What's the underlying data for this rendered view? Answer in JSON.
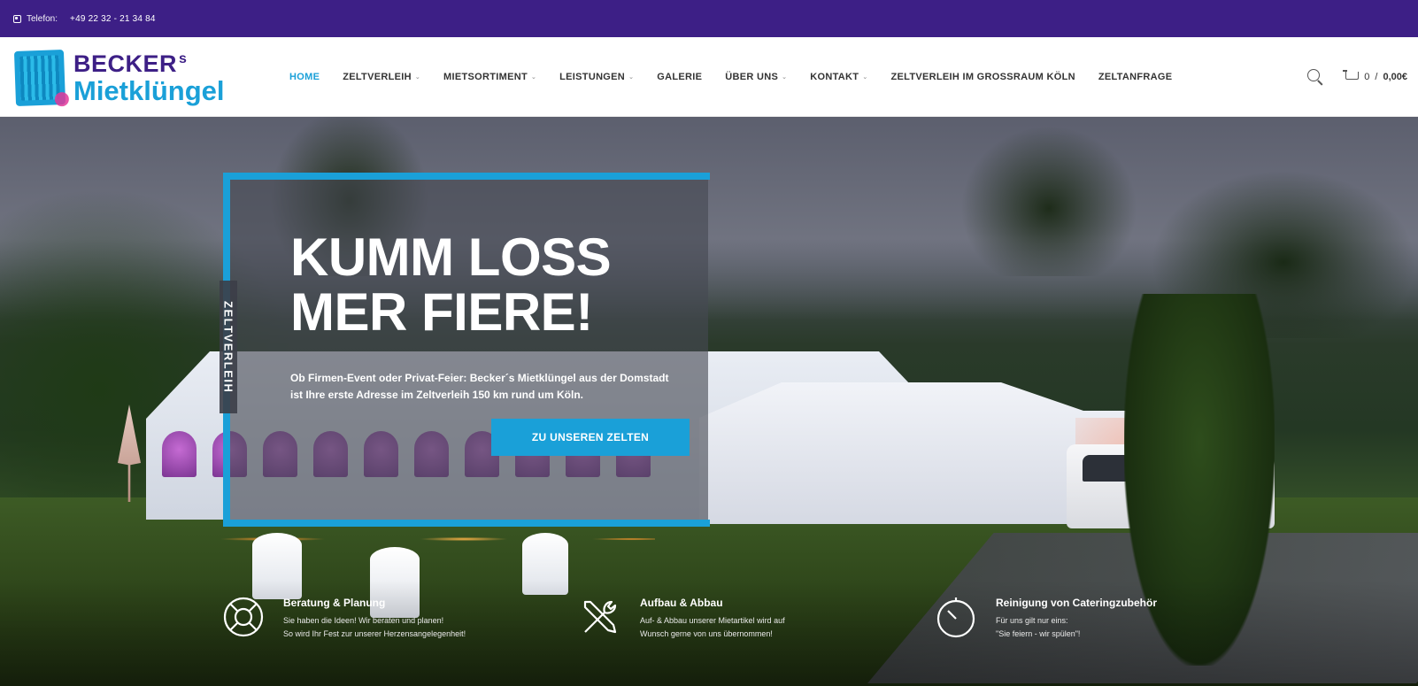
{
  "topbar": {
    "phone_label": "Telefon:",
    "phone_number": "+49 22 32 - 21 34 84"
  },
  "logo": {
    "line1": "BECKER",
    "line1_sup": "s",
    "line2": "Mietklüngel"
  },
  "nav": {
    "items": [
      {
        "label": "HOME",
        "active": true,
        "dropdown": false
      },
      {
        "label": "ZELTVERLEIH",
        "active": false,
        "dropdown": true
      },
      {
        "label": "MIETSORTIMENT",
        "active": false,
        "dropdown": true
      },
      {
        "label": "LEISTUNGEN",
        "active": false,
        "dropdown": true
      },
      {
        "label": "GALERIE",
        "active": false,
        "dropdown": false
      },
      {
        "label": "ÜBER UNS",
        "active": false,
        "dropdown": true
      },
      {
        "label": "KONTAKT",
        "active": false,
        "dropdown": true
      },
      {
        "label": "ZELTVERLEIH IM GROSSRAUM KÖLN",
        "active": false,
        "dropdown": false
      },
      {
        "label": "ZELTANFRAGE",
        "active": false,
        "dropdown": false
      }
    ],
    "cart_count": "0",
    "cart_total": "0,00€"
  },
  "hero": {
    "vertical_label": "ZELTVERLEIH",
    "headline_line1": "KUMM LOSS",
    "headline_line2": "MER FIERE!",
    "subtitle": "Ob Firmen-Event oder Privat-Feier: Becker´s Mietklüngel aus der Domstadt ist Ihre erste Adresse im Zeltverleih 150 km rund um Köln.",
    "cta_label": "ZU UNSEREN ZELTEN"
  },
  "features": [
    {
      "title": "Beratung & Planung",
      "line1": "Sie haben die Ideen! Wir beraten und planen!",
      "line2": "So wird Ihr Fest zur unserer Herzensangelegenheit!",
      "icon": "lifebuoy-icon"
    },
    {
      "title": "Aufbau & Abbau",
      "line1": "Auf- & Abbau unserer Mietartikel wird auf",
      "line2": "Wunsch gerne von uns übernommen!",
      "icon": "tools-icon"
    },
    {
      "title": "Reinigung von Cateringzubehör",
      "line1": "Für uns gilt nur eins:",
      "line2": "\"Sie feiern - wir spülen\"!",
      "icon": "timer-icon"
    }
  ],
  "colors": {
    "topbar": "#3d1f86",
    "accent": "#1aa0d8",
    "brand_purple": "#3d1f86"
  }
}
